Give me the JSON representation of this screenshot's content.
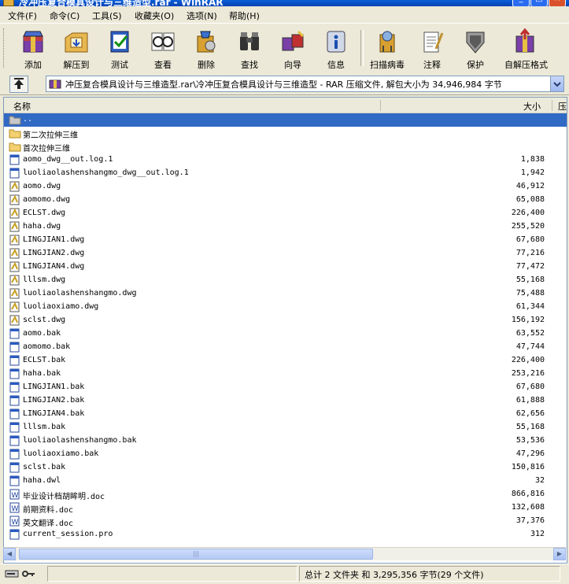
{
  "window": {
    "title": "冷冲压复合模具设计与三维造型.rar - WinRAR",
    "minimize_label": "_",
    "maximize_label": "□",
    "close_label": "×"
  },
  "menu": [
    {
      "label": "文件(F)"
    },
    {
      "label": "命令(C)"
    },
    {
      "label": "工具(S)"
    },
    {
      "label": "收藏夹(O)"
    },
    {
      "label": "选项(N)"
    },
    {
      "label": "帮助(H)"
    }
  ],
  "toolbar": [
    {
      "label": "添加",
      "icon": "add-icon"
    },
    {
      "label": "解压到",
      "icon": "extract-icon"
    },
    {
      "label": "测试",
      "icon": "test-icon"
    },
    {
      "label": "查看",
      "icon": "view-icon"
    },
    {
      "label": "删除",
      "icon": "delete-icon"
    },
    {
      "label": "查找",
      "icon": "find-icon"
    },
    {
      "label": "向导",
      "icon": "wizard-icon"
    },
    {
      "label": "信息",
      "icon": "info-icon"
    },
    {
      "label": "扫描病毒",
      "icon": "virus-scan-icon"
    },
    {
      "label": "注释",
      "icon": "comment-icon"
    },
    {
      "label": "保护",
      "icon": "protect-icon"
    },
    {
      "label": "自解压格式",
      "icon": "sfx-icon"
    }
  ],
  "address": {
    "path": "冲压复合模具设计与三维造型.rar\\冷冲压复合模具设计与三维造型 - RAR 压缩文件, 解包大小为 34,946,984 字节"
  },
  "columns": {
    "name": "名称",
    "size": "大小",
    "packed": "压"
  },
  "files": [
    {
      "name": "..",
      "size": "",
      "type": "up",
      "selected": true
    },
    {
      "name": "第二次拉伸三维",
      "size": "",
      "type": "folder"
    },
    {
      "name": "首次拉伸三维",
      "size": "",
      "type": "folder"
    },
    {
      "name": "aomo_dwg__out.log.1",
      "size": "1,838",
      "type": "file"
    },
    {
      "name": "luoliaolashenshangmo_dwg__out.log.1",
      "size": "1,942",
      "type": "file"
    },
    {
      "name": "aomo.dwg",
      "size": "46,912",
      "type": "dwg"
    },
    {
      "name": "aomomo.dwg",
      "size": "65,088",
      "type": "dwg"
    },
    {
      "name": "ECLST.dwg",
      "size": "226,400",
      "type": "dwg"
    },
    {
      "name": "haha.dwg",
      "size": "255,520",
      "type": "dwg"
    },
    {
      "name": "LINGJIAN1.dwg",
      "size": "67,680",
      "type": "dwg"
    },
    {
      "name": "LINGJIAN2.dwg",
      "size": "77,216",
      "type": "dwg"
    },
    {
      "name": "LINGJIAN4.dwg",
      "size": "77,472",
      "type": "dwg"
    },
    {
      "name": "lllsm.dwg",
      "size": "55,168",
      "type": "dwg"
    },
    {
      "name": "luoliaolashenshangmo.dwg",
      "size": "75,488",
      "type": "dwg"
    },
    {
      "name": "luoliaoxiamo.dwg",
      "size": "61,344",
      "type": "dwg"
    },
    {
      "name": "sclst.dwg",
      "size": "156,192",
      "type": "dwg"
    },
    {
      "name": "aomo.bak",
      "size": "63,552",
      "type": "file"
    },
    {
      "name": "aomomo.bak",
      "size": "47,744",
      "type": "file"
    },
    {
      "name": "ECLST.bak",
      "size": "226,400",
      "type": "file"
    },
    {
      "name": "haha.bak",
      "size": "253,216",
      "type": "file"
    },
    {
      "name": "LINGJIAN1.bak",
      "size": "67,680",
      "type": "file"
    },
    {
      "name": "LINGJIAN2.bak",
      "size": "61,888",
      "type": "file"
    },
    {
      "name": "LINGJIAN4.bak",
      "size": "62,656",
      "type": "file"
    },
    {
      "name": "lllsm.bak",
      "size": "55,168",
      "type": "file"
    },
    {
      "name": "luoliaolashenshangmo.bak",
      "size": "53,536",
      "type": "file"
    },
    {
      "name": "luoliaoxiamo.bak",
      "size": "47,296",
      "type": "file"
    },
    {
      "name": "sclst.bak",
      "size": "150,816",
      "type": "file"
    },
    {
      "name": "haha.dwl",
      "size": "32",
      "type": "file"
    },
    {
      "name": "毕业设计档胡眸明.doc",
      "size": "866,816",
      "type": "doc"
    },
    {
      "name": "前期资料.doc",
      "size": "132,608",
      "type": "doc"
    },
    {
      "name": "英文翻译.doc",
      "size": "37,376",
      "type": "doc"
    },
    {
      "name": "current_session.pro",
      "size": "312",
      "type": "file"
    }
  ],
  "status": {
    "summary": "总计 2 文件夹 和 3,295,356 字节(29 个文件)"
  },
  "colors": {
    "selection": "#316ac5",
    "titlebar": "#0a5fd8",
    "background": "#ece9d8"
  }
}
